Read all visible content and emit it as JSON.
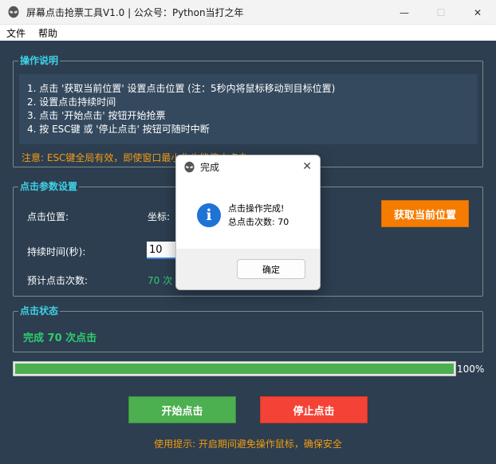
{
  "window": {
    "title": "屏幕点击抢票工具V1.0 | 公众号：Python当打之年",
    "minimize_glyph": "—",
    "maximize_glyph": "☐",
    "close_glyph": "✕"
  },
  "menu": {
    "items": [
      {
        "label": "文件"
      },
      {
        "label": "帮助"
      }
    ]
  },
  "instructions": {
    "title": "操作说明",
    "lines": [
      "1. 点击 '获取当前位置' 设置点击位置 (注：5秒内将鼠标移动到目标位置)",
      "2. 设置点击持续时间",
      "3. 点击 '开始点击' 按钮开始抢票",
      "4. 按 ESC键 或 '停止点击' 按钮可随时中断"
    ],
    "note": "注意: ESC键全局有效，即使窗口最小化也能停止点击"
  },
  "params": {
    "title": "点击参数设置",
    "position_label": "点击位置:",
    "coord_label": "坐标:",
    "get_position_button": "获取当前位置",
    "duration_label": "持续时间(秒):",
    "duration_value": "10",
    "count_label": "预计点击次数:",
    "count_value": "70 次"
  },
  "status": {
    "title": "点击状态",
    "text": "完成 70 次点击"
  },
  "progress": {
    "value": 1.0,
    "label": "100%"
  },
  "actions": {
    "start_label": "开始点击",
    "stop_label": "停止点击"
  },
  "tip": "使用提示: 开启期间避免操作鼠标，确保安全",
  "dialog": {
    "title": "完成",
    "close_glyph": "✕",
    "icon_glyph": "i",
    "line1": "点击操作完成!",
    "line2": "总点击次数: 70",
    "ok_label": "确定"
  },
  "colors": {
    "background": "#2c3e50",
    "accent_cyan": "#3fd0e6",
    "warning_orange": "#f39c12",
    "success_green": "#2ecc71",
    "start_green": "#4caf50",
    "stop_red": "#f44336",
    "get_orange": "#f57c00",
    "info_blue": "#1e73d6"
  }
}
